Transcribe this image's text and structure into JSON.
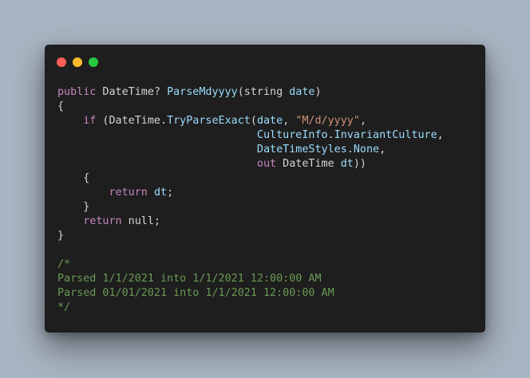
{
  "window": {
    "dots": [
      {
        "name": "close",
        "color": "#ff5f56"
      },
      {
        "name": "minimize",
        "color": "#ffbd2e"
      },
      {
        "name": "maximize",
        "color": "#27c93f"
      }
    ]
  },
  "theme": {
    "keyword": "#c586c0",
    "type": "#d4d4d4",
    "function": "#9cdcfe",
    "string": "#ce9178",
    "comment": "#6a9955",
    "default": "#d4d4d4"
  },
  "code_lines": [
    [
      {
        "t": "public",
        "c": "keyword"
      },
      {
        "t": " DateTime? ",
        "c": "default"
      },
      {
        "t": "ParseMdyyyy",
        "c": "function"
      },
      {
        "t": "(string ",
        "c": "default"
      },
      {
        "t": "date",
        "c": "function"
      },
      {
        "t": ")",
        "c": "default"
      }
    ],
    [
      {
        "t": "{",
        "c": "default"
      }
    ],
    [
      {
        "t": "    ",
        "c": "default"
      },
      {
        "t": "if",
        "c": "keyword"
      },
      {
        "t": " (DateTime.",
        "c": "default"
      },
      {
        "t": "TryParseExact",
        "c": "function"
      },
      {
        "t": "(",
        "c": "default"
      },
      {
        "t": "date",
        "c": "function"
      },
      {
        "t": ", ",
        "c": "default"
      },
      {
        "t": "\"M/d/yyyy\"",
        "c": "string"
      },
      {
        "t": ",",
        "c": "default"
      }
    ],
    [
      {
        "t": "                               ",
        "c": "default"
      },
      {
        "t": "CultureInfo",
        "c": "function"
      },
      {
        "t": ".",
        "c": "default"
      },
      {
        "t": "InvariantCulture",
        "c": "function"
      },
      {
        "t": ",",
        "c": "default"
      }
    ],
    [
      {
        "t": "                               ",
        "c": "default"
      },
      {
        "t": "DateTimeStyles",
        "c": "function"
      },
      {
        "t": ".",
        "c": "default"
      },
      {
        "t": "None",
        "c": "function"
      },
      {
        "t": ",",
        "c": "default"
      }
    ],
    [
      {
        "t": "                               ",
        "c": "default"
      },
      {
        "t": "out",
        "c": "keyword"
      },
      {
        "t": " DateTime ",
        "c": "default"
      },
      {
        "t": "dt",
        "c": "function"
      },
      {
        "t": "))",
        "c": "default"
      }
    ],
    [
      {
        "t": "    {",
        "c": "default"
      }
    ],
    [
      {
        "t": "        ",
        "c": "default"
      },
      {
        "t": "return",
        "c": "keyword"
      },
      {
        "t": " ",
        "c": "default"
      },
      {
        "t": "dt",
        "c": "function"
      },
      {
        "t": ";",
        "c": "default"
      }
    ],
    [
      {
        "t": "    }",
        "c": "default"
      }
    ],
    [
      {
        "t": "    ",
        "c": "default"
      },
      {
        "t": "return",
        "c": "keyword"
      },
      {
        "t": " null;",
        "c": "default"
      }
    ],
    [
      {
        "t": "}",
        "c": "default"
      }
    ],
    [],
    [
      {
        "t": "/*",
        "c": "comment"
      }
    ],
    [
      {
        "t": "Parsed 1/1/2021 into 1/1/2021 12:00:00 AM",
        "c": "comment"
      }
    ],
    [
      {
        "t": "Parsed 01/01/2021 into 1/1/2021 12:00:00 AM",
        "c": "comment"
      }
    ],
    [
      {
        "t": "*/",
        "c": "comment"
      }
    ]
  ]
}
